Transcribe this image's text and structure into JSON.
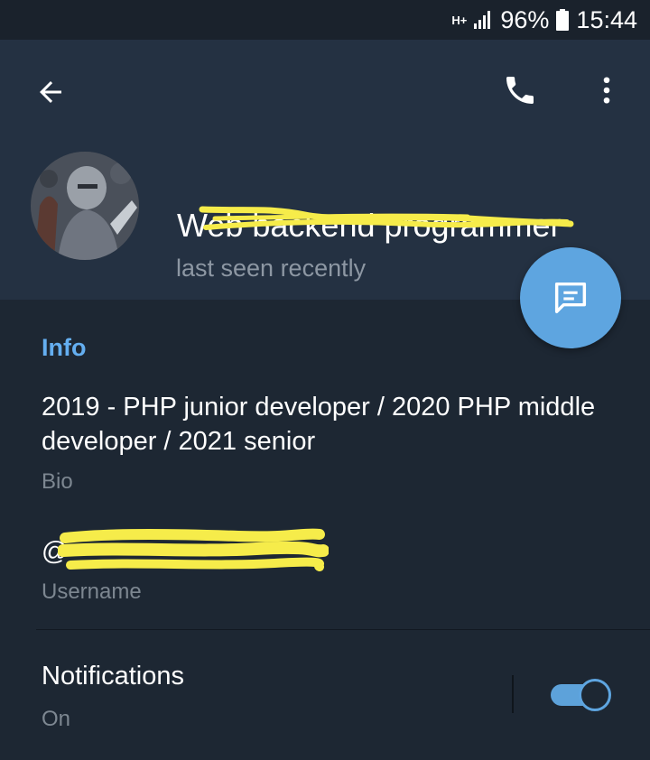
{
  "status_bar": {
    "network_type": "H+",
    "battery": "96%",
    "time": "15:44"
  },
  "toolbar": {
    "back_icon": "arrow-left-icon",
    "call_icon": "phone-icon",
    "more_icon": "more-vertical-icon"
  },
  "profile": {
    "name": "Web backend programmer",
    "last_seen": "last seen recently"
  },
  "fab": {
    "icon": "message-icon"
  },
  "info": {
    "section_title": "Info",
    "bio": "2019 - PHP junior developer / 2020 PHP middle developer / 2021 senior",
    "bio_label": "Bio",
    "username": "@",
    "username_label": "Username"
  },
  "notifications": {
    "title": "Notifications",
    "value": "On",
    "enabled": true
  },
  "colors": {
    "accent": "#5ea5e0",
    "header_bg": "#243142",
    "body_bg": "#1d2733",
    "redaction": "#f6ec4a"
  }
}
